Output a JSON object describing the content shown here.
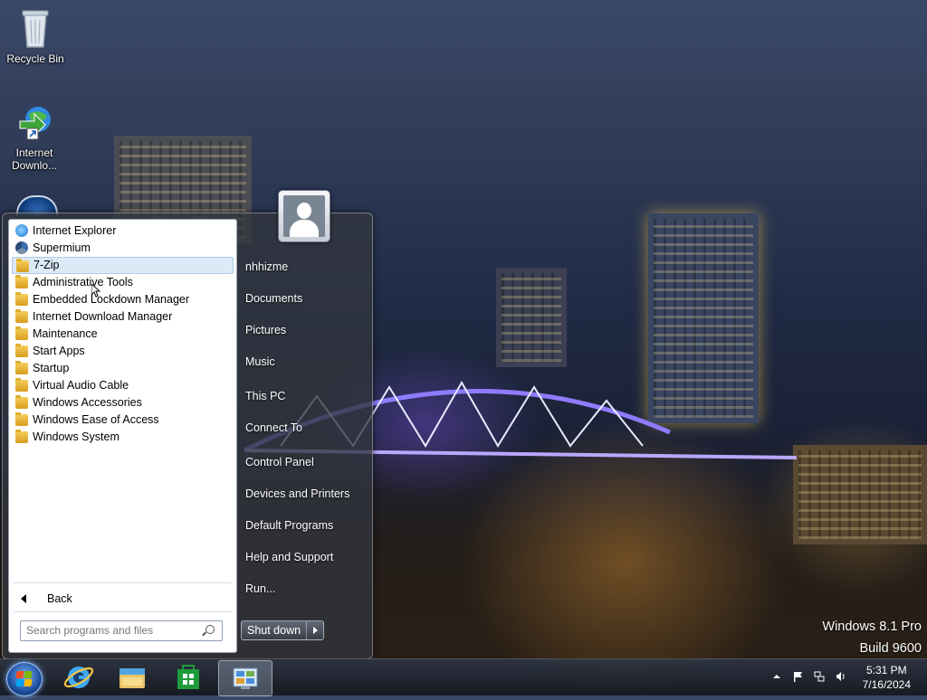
{
  "desktop": {
    "icons": [
      {
        "label": "Recycle Bin",
        "icon": "recycle-bin-icon"
      },
      {
        "label": "Internet Downlo...",
        "icon": "internet-download-manager-icon"
      }
    ]
  },
  "start_menu": {
    "programs": [
      {
        "label": "Internet Explorer",
        "icon": "internet-explorer-icon"
      },
      {
        "label": "Supermium",
        "icon": "supermium-icon"
      },
      {
        "label": "7-Zip",
        "icon": "folder-icon",
        "selected": true
      },
      {
        "label": "Administrative Tools",
        "icon": "folder-icon"
      },
      {
        "label": "Embedded Lockdown Manager",
        "icon": "folder-icon"
      },
      {
        "label": "Internet Download Manager",
        "icon": "folder-icon"
      },
      {
        "label": "Maintenance",
        "icon": "folder-icon"
      },
      {
        "label": "Start Apps",
        "icon": "folder-icon"
      },
      {
        "label": "Startup",
        "icon": "folder-icon"
      },
      {
        "label": "Virtual Audio Cable",
        "icon": "folder-icon"
      },
      {
        "label": "Windows Accessories",
        "icon": "folder-icon"
      },
      {
        "label": "Windows Ease of Access",
        "icon": "folder-icon"
      },
      {
        "label": "Windows System",
        "icon": "folder-icon"
      }
    ],
    "back_label": "Back",
    "search_placeholder": "Search programs and files",
    "right_items": [
      "nhhizme",
      "Documents",
      "Pictures",
      "Music",
      "This PC",
      "Connect To",
      "Control Panel",
      "Devices and Printers",
      "Default Programs",
      "Help and Support",
      "Run..."
    ],
    "shutdown_label": "Shut down"
  },
  "watermark": {
    "line1": "Windows 8.1 Pro",
    "line2": "Build 9600"
  },
  "taskbar": {
    "pinned": [
      "start-orb-icon",
      "internet-explorer-icon",
      "file-explorer-icon",
      "store-icon",
      "control-panel-icon"
    ],
    "active": "control-panel-icon"
  },
  "tray": {
    "icons": [
      "show-hidden-icons-icon",
      "action-center-flag-icon",
      "network-icon",
      "volume-icon"
    ],
    "time": "5:31 PM",
    "date": "7/16/2024"
  },
  "colors": {
    "selection": "#dceaf7",
    "folder": "#e6b33a",
    "taskbar": "#1e2838"
  }
}
